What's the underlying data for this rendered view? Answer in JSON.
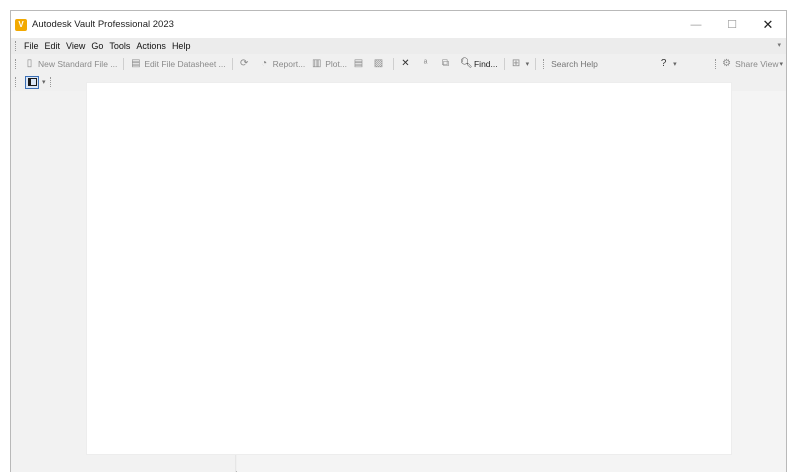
{
  "window": {
    "title": "Autodesk Vault Professional 2023",
    "app_icon_letter": "V",
    "controls": {
      "minimize": "—",
      "maximize": "☐",
      "close": "✕"
    }
  },
  "menubar": {
    "items": [
      "File",
      "Edit",
      "View",
      "Go",
      "Tools",
      "Actions",
      "Help"
    ],
    "overflow": "▾"
  },
  "toolbar": {
    "new_standard_file": "New Standard File ...",
    "edit_file_datasheet": "Edit File Datasheet ...",
    "report": "Report...",
    "plot": "Plot...",
    "find": "Find...",
    "search_placeholder": "Search Help",
    "share_view": "Share View"
  },
  "colors": {
    "accent": "#3b6fb5",
    "app_icon": "#f2a900"
  }
}
